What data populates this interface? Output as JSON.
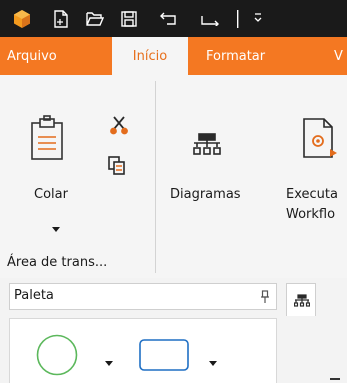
{
  "tabs": {
    "file": "Arquivo",
    "home": "Início",
    "format": "Formatar",
    "more": "V"
  },
  "ribbon": {
    "paste_label": "Colar",
    "clipboard_group": "Área de trans...",
    "diagrams_label": "Diagramas",
    "workflow_line1": "Executa",
    "workflow_line2": "Workflo"
  },
  "palette": {
    "title": "Paleta"
  },
  "colors": {
    "titlebar": "#1a1a1a",
    "tabs_bar": "#f47822",
    "accent": "#f47822",
    "ribbon_bg": "#f5f5f5",
    "circle_shape": "#5cb85c",
    "rect_shape": "#1f6fc4"
  }
}
